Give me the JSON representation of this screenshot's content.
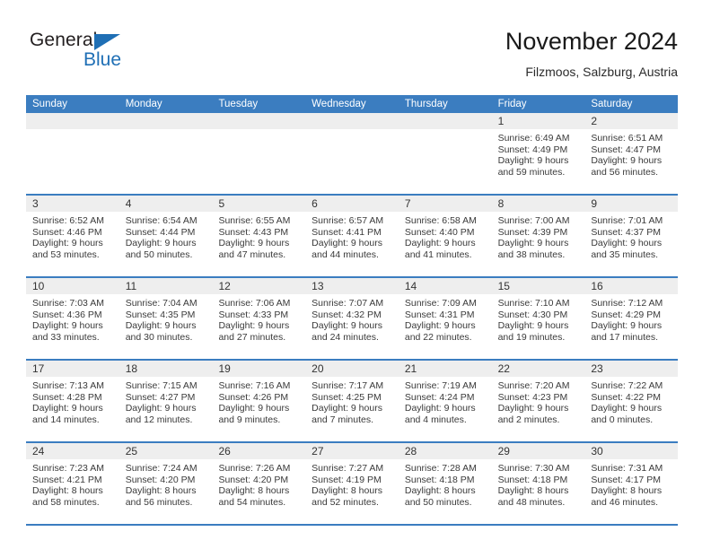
{
  "logo": {
    "word_one": "General",
    "word_two": "Blue",
    "triangle_color": "#1f6fb5",
    "text_color": "#231f20"
  },
  "header": {
    "title": "November 2024",
    "subtitle": "Filzmoos, Salzburg, Austria"
  },
  "theme": {
    "header_blue": "#3b7dc0",
    "day_band_gray": "#eeeeee",
    "text_dark": "#333333"
  },
  "weekdays": [
    "Sunday",
    "Monday",
    "Tuesday",
    "Wednesday",
    "Thursday",
    "Friday",
    "Saturday"
  ],
  "weeks": [
    [
      {
        "day": "",
        "sunrise": "",
        "sunset": "",
        "daylight_1": "",
        "daylight_2": ""
      },
      {
        "day": "",
        "sunrise": "",
        "sunset": "",
        "daylight_1": "",
        "daylight_2": ""
      },
      {
        "day": "",
        "sunrise": "",
        "sunset": "",
        "daylight_1": "",
        "daylight_2": ""
      },
      {
        "day": "",
        "sunrise": "",
        "sunset": "",
        "daylight_1": "",
        "daylight_2": ""
      },
      {
        "day": "",
        "sunrise": "",
        "sunset": "",
        "daylight_1": "",
        "daylight_2": ""
      },
      {
        "day": "1",
        "sunrise": "Sunrise: 6:49 AM",
        "sunset": "Sunset: 4:49 PM",
        "daylight_1": "Daylight: 9 hours",
        "daylight_2": "and 59 minutes."
      },
      {
        "day": "2",
        "sunrise": "Sunrise: 6:51 AM",
        "sunset": "Sunset: 4:47 PM",
        "daylight_1": "Daylight: 9 hours",
        "daylight_2": "and 56 minutes."
      }
    ],
    [
      {
        "day": "3",
        "sunrise": "Sunrise: 6:52 AM",
        "sunset": "Sunset: 4:46 PM",
        "daylight_1": "Daylight: 9 hours",
        "daylight_2": "and 53 minutes."
      },
      {
        "day": "4",
        "sunrise": "Sunrise: 6:54 AM",
        "sunset": "Sunset: 4:44 PM",
        "daylight_1": "Daylight: 9 hours",
        "daylight_2": "and 50 minutes."
      },
      {
        "day": "5",
        "sunrise": "Sunrise: 6:55 AM",
        "sunset": "Sunset: 4:43 PM",
        "daylight_1": "Daylight: 9 hours",
        "daylight_2": "and 47 minutes."
      },
      {
        "day": "6",
        "sunrise": "Sunrise: 6:57 AM",
        "sunset": "Sunset: 4:41 PM",
        "daylight_1": "Daylight: 9 hours",
        "daylight_2": "and 44 minutes."
      },
      {
        "day": "7",
        "sunrise": "Sunrise: 6:58 AM",
        "sunset": "Sunset: 4:40 PM",
        "daylight_1": "Daylight: 9 hours",
        "daylight_2": "and 41 minutes."
      },
      {
        "day": "8",
        "sunrise": "Sunrise: 7:00 AM",
        "sunset": "Sunset: 4:39 PM",
        "daylight_1": "Daylight: 9 hours",
        "daylight_2": "and 38 minutes."
      },
      {
        "day": "9",
        "sunrise": "Sunrise: 7:01 AM",
        "sunset": "Sunset: 4:37 PM",
        "daylight_1": "Daylight: 9 hours",
        "daylight_2": "and 35 minutes."
      }
    ],
    [
      {
        "day": "10",
        "sunrise": "Sunrise: 7:03 AM",
        "sunset": "Sunset: 4:36 PM",
        "daylight_1": "Daylight: 9 hours",
        "daylight_2": "and 33 minutes."
      },
      {
        "day": "11",
        "sunrise": "Sunrise: 7:04 AM",
        "sunset": "Sunset: 4:35 PM",
        "daylight_1": "Daylight: 9 hours",
        "daylight_2": "and 30 minutes."
      },
      {
        "day": "12",
        "sunrise": "Sunrise: 7:06 AM",
        "sunset": "Sunset: 4:33 PM",
        "daylight_1": "Daylight: 9 hours",
        "daylight_2": "and 27 minutes."
      },
      {
        "day": "13",
        "sunrise": "Sunrise: 7:07 AM",
        "sunset": "Sunset: 4:32 PM",
        "daylight_1": "Daylight: 9 hours",
        "daylight_2": "and 24 minutes."
      },
      {
        "day": "14",
        "sunrise": "Sunrise: 7:09 AM",
        "sunset": "Sunset: 4:31 PM",
        "daylight_1": "Daylight: 9 hours",
        "daylight_2": "and 22 minutes."
      },
      {
        "day": "15",
        "sunrise": "Sunrise: 7:10 AM",
        "sunset": "Sunset: 4:30 PM",
        "daylight_1": "Daylight: 9 hours",
        "daylight_2": "and 19 minutes."
      },
      {
        "day": "16",
        "sunrise": "Sunrise: 7:12 AM",
        "sunset": "Sunset: 4:29 PM",
        "daylight_1": "Daylight: 9 hours",
        "daylight_2": "and 17 minutes."
      }
    ],
    [
      {
        "day": "17",
        "sunrise": "Sunrise: 7:13 AM",
        "sunset": "Sunset: 4:28 PM",
        "daylight_1": "Daylight: 9 hours",
        "daylight_2": "and 14 minutes."
      },
      {
        "day": "18",
        "sunrise": "Sunrise: 7:15 AM",
        "sunset": "Sunset: 4:27 PM",
        "daylight_1": "Daylight: 9 hours",
        "daylight_2": "and 12 minutes."
      },
      {
        "day": "19",
        "sunrise": "Sunrise: 7:16 AM",
        "sunset": "Sunset: 4:26 PM",
        "daylight_1": "Daylight: 9 hours",
        "daylight_2": "and 9 minutes."
      },
      {
        "day": "20",
        "sunrise": "Sunrise: 7:17 AM",
        "sunset": "Sunset: 4:25 PM",
        "daylight_1": "Daylight: 9 hours",
        "daylight_2": "and 7 minutes."
      },
      {
        "day": "21",
        "sunrise": "Sunrise: 7:19 AM",
        "sunset": "Sunset: 4:24 PM",
        "daylight_1": "Daylight: 9 hours",
        "daylight_2": "and 4 minutes."
      },
      {
        "day": "22",
        "sunrise": "Sunrise: 7:20 AM",
        "sunset": "Sunset: 4:23 PM",
        "daylight_1": "Daylight: 9 hours",
        "daylight_2": "and 2 minutes."
      },
      {
        "day": "23",
        "sunrise": "Sunrise: 7:22 AM",
        "sunset": "Sunset: 4:22 PM",
        "daylight_1": "Daylight: 9 hours",
        "daylight_2": "and 0 minutes."
      }
    ],
    [
      {
        "day": "24",
        "sunrise": "Sunrise: 7:23 AM",
        "sunset": "Sunset: 4:21 PM",
        "daylight_1": "Daylight: 8 hours",
        "daylight_2": "and 58 minutes."
      },
      {
        "day": "25",
        "sunrise": "Sunrise: 7:24 AM",
        "sunset": "Sunset: 4:20 PM",
        "daylight_1": "Daylight: 8 hours",
        "daylight_2": "and 56 minutes."
      },
      {
        "day": "26",
        "sunrise": "Sunrise: 7:26 AM",
        "sunset": "Sunset: 4:20 PM",
        "daylight_1": "Daylight: 8 hours",
        "daylight_2": "and 54 minutes."
      },
      {
        "day": "27",
        "sunrise": "Sunrise: 7:27 AM",
        "sunset": "Sunset: 4:19 PM",
        "daylight_1": "Daylight: 8 hours",
        "daylight_2": "and 52 minutes."
      },
      {
        "day": "28",
        "sunrise": "Sunrise: 7:28 AM",
        "sunset": "Sunset: 4:18 PM",
        "daylight_1": "Daylight: 8 hours",
        "daylight_2": "and 50 minutes."
      },
      {
        "day": "29",
        "sunrise": "Sunrise: 7:30 AM",
        "sunset": "Sunset: 4:18 PM",
        "daylight_1": "Daylight: 8 hours",
        "daylight_2": "and 48 minutes."
      },
      {
        "day": "30",
        "sunrise": "Sunrise: 7:31 AM",
        "sunset": "Sunset: 4:17 PM",
        "daylight_1": "Daylight: 8 hours",
        "daylight_2": "and 46 minutes."
      }
    ]
  ]
}
